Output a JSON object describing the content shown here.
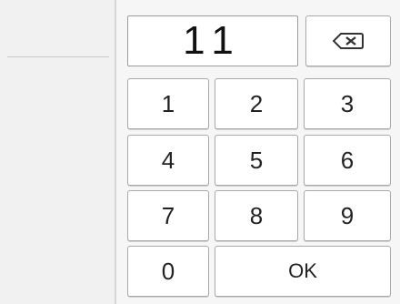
{
  "entry": {
    "value": "11"
  },
  "keys": {
    "k1": "1",
    "k2": "2",
    "k3": "3",
    "k4": "4",
    "k5": "5",
    "k6": "6",
    "k7": "7",
    "k8": "8",
    "k9": "9",
    "k0": "0",
    "ok": "OK"
  },
  "icons": {
    "backspace": "backspace-icon"
  }
}
